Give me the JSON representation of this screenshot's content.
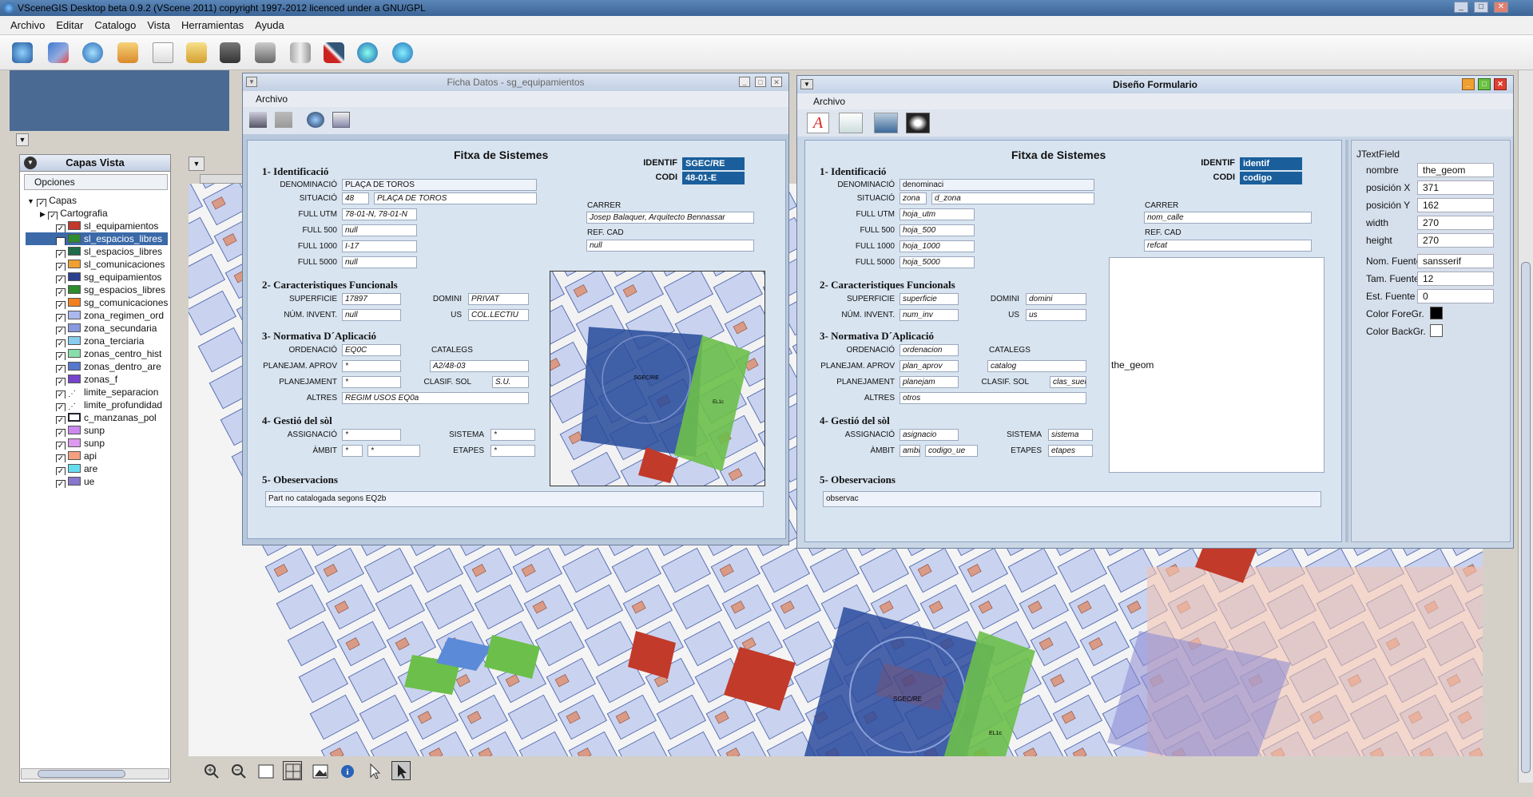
{
  "app": {
    "title": "VSceneGIS Desktop  beta 0.9.2    (VScene 2011) copyright 1997-2012 licenced under a GNU/GPL"
  },
  "menu": [
    "Archivo",
    "Editar",
    "Catalogo",
    "Vista",
    "Herramientas",
    "Ayuda"
  ],
  "toolbar": {
    "icons": [
      "globe-settings-icon",
      "network-icon",
      "globe-icon",
      "layers-icon",
      "new-doc-icon",
      "open-folder-icon",
      "save-icon",
      "print-icon",
      "server-icon",
      "tools-icon",
      "back-icon",
      "refresh-icon"
    ]
  },
  "layers_panel": {
    "title": "Capas Vista",
    "options_label": "Opciones",
    "root": "Capas",
    "group": "Cartografia",
    "items": [
      {
        "name": "sl_equipamientos",
        "color": "#c0392b"
      },
      {
        "name": "sl_espacios_libres",
        "color": "#2e8b2e",
        "selected": true
      },
      {
        "name": "sl_espacios_libres",
        "color": "#1e6b4a"
      },
      {
        "name": "sl_comunicaciones",
        "color": "#f0a030"
      },
      {
        "name": "sg_equipamientos",
        "color": "#2b3f8f"
      },
      {
        "name": "sg_espacios_libres",
        "color": "#2e8b2e"
      },
      {
        "name": "sg_comunicaciones",
        "color": "#f08020"
      },
      {
        "name": "zona_regimen_ord",
        "color": "#aab8ee"
      },
      {
        "name": "zona_secundaria",
        "color": "#8899dd"
      },
      {
        "name": "zona_terciaria",
        "color": "#88ccee"
      },
      {
        "name": "zonas_centro_hist",
        "color": "#88ddaa"
      },
      {
        "name": "zonas_dentro_are",
        "color": "#5577cc"
      },
      {
        "name": "zonas_f",
        "color": "#7744cc"
      },
      {
        "name": "limite_separacion",
        "color": "#ffffff"
      },
      {
        "name": "limite_profundidad",
        "color": "#ffffff"
      },
      {
        "name": "c_manzanas_pol",
        "color": "#ffffff"
      },
      {
        "name": "sunp",
        "color": "#cc88ee"
      },
      {
        "name": "sunp",
        "color": "#dd99ee"
      },
      {
        "name": "api",
        "color": "#f4a080"
      },
      {
        "name": "are",
        "color": "#66ddee"
      },
      {
        "name": "ue",
        "color": "#8877cc"
      }
    ]
  },
  "ficha": {
    "window_title": "Ficha Datos - sg_equipamientos",
    "menu": "Archivo",
    "form_title": "Fitxa de Sistemes",
    "identif_label": "IDENTIF",
    "identif": "SGEC/RE",
    "codi_label": "CODI",
    "codi": "48-01-E",
    "s1": "1- Identificació",
    "denominacio_label": "DENOMINACIÓ",
    "denominacio": "PLAÇA DE TOROS",
    "situacio_label": "SITUACIÓ",
    "situacio_num": "48",
    "situacio": "PLAÇA DE TOROS",
    "utm_label": "FULL UTM",
    "utm": "78-01-N, 78-01-N",
    "f500_label": "FULL 500",
    "f500": "null",
    "f1000_label": "FULL 1000",
    "f1000": "I-17",
    "f5000_label": "FULL 5000",
    "f5000": "null",
    "carrer_label": "CARRER",
    "carrer": "Josep Balaquer, Arquitecto Bennassar",
    "refcad_label": "REF. CAD",
    "refcad": "null",
    "s2": "2- Caracteristiques Funcionals",
    "superficie_label": "SUPERFICIE",
    "superficie": "17897",
    "domini_label": "DOMINI",
    "domini": "PRIVAT",
    "ninvent_label": "NÚM. INVENT.",
    "ninvent": "null",
    "us_label": "US",
    "us": "COL.LECTIU",
    "s3": "3- Normativa D´Aplicació",
    "ordenacio_label": "ORDENACIÓ",
    "ordenacio": "EQ0C",
    "catalegs_label": "CATALEGS",
    "planaprov_label": "PLANEJAM. APROV",
    "planaprov": "*",
    "catalegs": "A2/48-03",
    "planejament_label": "PLANEJAMENT",
    "planejament": "*",
    "clasif_label": "CLASIF. SOL",
    "clasif": "S.U.",
    "altres_label": "ALTRES",
    "altres": "REGIM USOS EQ0a",
    "s4": "4- Gestió del sòl",
    "assignacio_label": "ASSIGNACIÓ",
    "assignacio": "*",
    "sistema_label": "SISTEMA",
    "sistema": "*",
    "ambit_label": "ÀMBIT",
    "ambit1": "*",
    "ambit2": "*",
    "etapes_label": "ETAPES",
    "etapes": "*",
    "s5": "5- Obeservacions",
    "observacions": "Part no catalogada segons EQ2b"
  },
  "diseno": {
    "window_title": "Diseño Formulario",
    "menu": "Archivo",
    "form_title": "Fitxa de Sistemes",
    "identif_label": "IDENTIF",
    "identif": "identif",
    "codi_label": "CODI",
    "codi": "codigo",
    "s1": "1- Identificació",
    "denominacio_label": "DENOMINACIÓ",
    "denominacio": "denominaci",
    "situacio_label": "SITUACIÓ",
    "situacio_num": "zona",
    "situacio": "d_zona",
    "utm_label": "FULL UTM",
    "utm": "hoja_utm",
    "f500_label": "FULL 500",
    "f500": "hoja_500",
    "f1000_label": "FULL 1000",
    "f1000": "hoja_1000",
    "f5000_label": "FULL 5000",
    "f5000": "hoja_5000",
    "carrer_label": "CARRER",
    "carrer": "nom_calle",
    "refcad_label": "REF. CAD",
    "refcad": "refcat",
    "s2": "2- Caracteristiques Funcionals",
    "superficie_label": "SUPERFICIE",
    "superficie": "superficie",
    "domini_label": "DOMINI",
    "domini": "domini",
    "ninvent_label": "NÚM. INVENT.",
    "ninvent": "num_inv",
    "us_label": "US",
    "us": "us",
    "s3": "3- Normativa D´Aplicació",
    "ordenacio_label": "ORDENACIÓ",
    "ordenacio": "ordenacion",
    "catalegs_label": "CATALEGS",
    "planaprov_label": "PLANEJAM. APROV",
    "planaprov": "plan_aprov",
    "catalegs": "catalog",
    "planejament_label": "PLANEJAMENT",
    "planejament": "planejam",
    "clasif_label": "CLASIF. SOL",
    "clasif": "clas_suelo",
    "altres_label": "ALTRES",
    "altres": "otros",
    "s4": "4- Gestió del sòl",
    "assignacio_label": "ASSIGNACIÓ",
    "assignacio": "asignacio",
    "sistema_label": "SISTEMA",
    "sistema": "sistema",
    "ambit_label": "ÀMBIT",
    "ambit1": "ambit",
    "ambit2": "codigo_ue",
    "etapes_label": "ETAPES",
    "etapes": "etapes",
    "s5": "5- Obeservacions",
    "observacions": "observac",
    "geom_label": "the_geom"
  },
  "properties": {
    "title": "JTextField",
    "nombre_label": "nombre",
    "nombre": "the_geom",
    "posx_label": "posición X",
    "posx": "371",
    "posy_label": "posición Y",
    "posy": "162",
    "width_label": "width",
    "width": "270",
    "height_label": "height",
    "height": "270",
    "nomfuente_label": "Nom. Fuente",
    "nomfuente": "sansserif",
    "tamfuente_label": "Tam. Fuente",
    "tamfuente": "12",
    "estfuente_label": "Est. Fuente",
    "estfuente": "0",
    "colorfore_label": "Color ForeGr.",
    "colorfore": "#000000",
    "colorback_label": "Color BackGr.",
    "colorback": "#ffffff"
  },
  "map_labels": {
    "sgec": "SGEC/RE",
    "el": "EL1c"
  }
}
